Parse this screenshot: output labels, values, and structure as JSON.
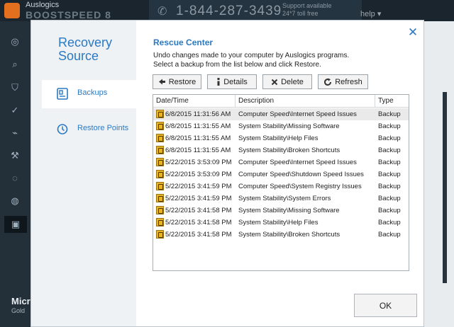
{
  "app": {
    "brand": "Auslogics",
    "brand_product": "BOOSTSPEED 8",
    "phone": "1-844-287-3439",
    "support_line1": "Support available",
    "support_line2": "24*7 toll free",
    "help_label": "help ▾",
    "footer_title": "Micr",
    "footer_sub": "Gold"
  },
  "dialog": {
    "panel_title_line1": "Recovery",
    "panel_title_line2": "Source",
    "nav": [
      {
        "label": "Backups",
        "icon": "backup-icon",
        "selected": true
      },
      {
        "label": "Restore Points",
        "icon": "restore-points-icon",
        "selected": false
      }
    ],
    "close_label": "✕",
    "title": "Rescue Center",
    "description_line1": "Undo changes made to your computer by Auslogics programs.",
    "description_line2": "Select a backup from the list below and click Restore.",
    "toolbar": {
      "restore": "Restore",
      "details": "Details",
      "delete": "Delete",
      "refresh": "Refresh"
    },
    "table": {
      "columns": [
        "Date/Time",
        "Description",
        "Type"
      ],
      "rows": [
        {
          "date": "6/8/2015 11:31:56 AM",
          "description": "Computer Speed\\Internet Speed Issues",
          "type": "Backup"
        },
        {
          "date": "6/8/2015 11:31:55 AM",
          "description": "System Stability\\Missing Software",
          "type": "Backup"
        },
        {
          "date": "6/8/2015 11:31:55 AM",
          "description": "System Stability\\Help Files",
          "type": "Backup"
        },
        {
          "date": "6/8/2015 11:31:55 AM",
          "description": "System Stability\\Broken Shortcuts",
          "type": "Backup"
        },
        {
          "date": "5/22/2015 3:53:09 PM",
          "description": "Computer Speed\\Internet Speed Issues",
          "type": "Backup"
        },
        {
          "date": "5/22/2015 3:53:09 PM",
          "description": "Computer Speed\\Shutdown Speed Issues",
          "type": "Backup"
        },
        {
          "date": "5/22/2015 3:41:59 PM",
          "description": "Computer Speed\\System Registry Issues",
          "type": "Backup"
        },
        {
          "date": "5/22/2015 3:41:59 PM",
          "description": "System Stability\\System Errors",
          "type": "Backup"
        },
        {
          "date": "5/22/2015 3:41:58 PM",
          "description": "System Stability\\Missing Software",
          "type": "Backup"
        },
        {
          "date": "5/22/2015 3:41:58 PM",
          "description": "System Stability\\Help Files",
          "type": "Backup"
        },
        {
          "date": "5/22/2015 3:41:58 PM",
          "description": "System Stability\\Broken Shortcuts",
          "type": "Backup"
        }
      ]
    },
    "ok_label": "OK"
  },
  "colors": {
    "accent": "#2b79c1",
    "panel_bg": "#eef2f5",
    "app_bg": "#1f2a33",
    "brand_orange": "#e3701e",
    "row_icon": "#e8b423"
  }
}
